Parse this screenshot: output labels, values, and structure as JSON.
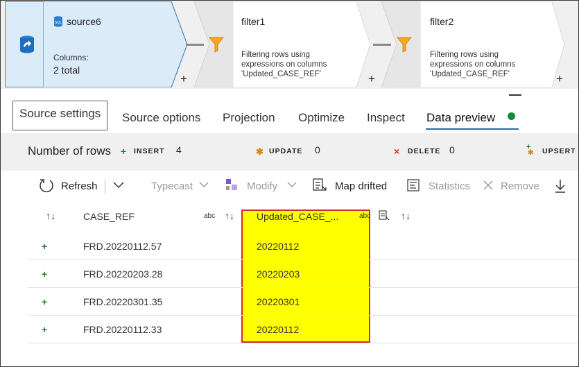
{
  "pipeline": {
    "source": {
      "name": "source6",
      "columns_label": "Columns:",
      "columns_value": "2 total",
      "icon": "sql-database-icon"
    },
    "nodes": [
      {
        "name": "filter1",
        "description": "Filtering rows using expressions on columns 'Updated_CASE_REF'",
        "icon": "funnel-icon"
      },
      {
        "name": "filter2",
        "description": "Filtering rows using expressions on columns 'Updated_CASE_REF'",
        "icon": "funnel-icon"
      }
    ],
    "add_symbol": "+"
  },
  "tabs": [
    "Source settings",
    "Source options",
    "Projection",
    "Optimize",
    "Inspect",
    "Data preview"
  ],
  "active_tab": "Data preview",
  "status_color": "#138a3a",
  "counts": {
    "label": "Number of rows",
    "insert_label": "INSERT",
    "insert_value": "4",
    "update_label": "UPDATE",
    "update_value": "0",
    "delete_label": "DELETE",
    "delete_value": "0",
    "upsert_label": "UPSERT"
  },
  "toolbar": {
    "refresh": "Refresh",
    "typecast": "Typecast",
    "modify": "Modify",
    "map_drifted": "Map drifted",
    "statistics": "Statistics",
    "remove": "Remove"
  },
  "grid": {
    "columns": [
      {
        "name": "CASE_REF",
        "type": "abc"
      },
      {
        "name": "Updated_CASE_...",
        "type": "abc"
      }
    ],
    "rows": [
      {
        "marker": "+",
        "case_ref": "FRD.20220112.57",
        "updated": "20220112"
      },
      {
        "marker": "+",
        "case_ref": "FRD.20220203.28",
        "updated": "20220203"
      },
      {
        "marker": "+",
        "case_ref": "FRD.20220301.35",
        "updated": "20220301"
      },
      {
        "marker": "+",
        "case_ref": "FRD.20220112.33",
        "updated": "20220112"
      }
    ]
  },
  "colors": {
    "highlight": "#ffff00",
    "highlight_border": "#d42a2a",
    "accent": "#1a6fb4",
    "insert": "#2a7a2a",
    "update": "#d4881a",
    "delete": "#d42a2a"
  }
}
